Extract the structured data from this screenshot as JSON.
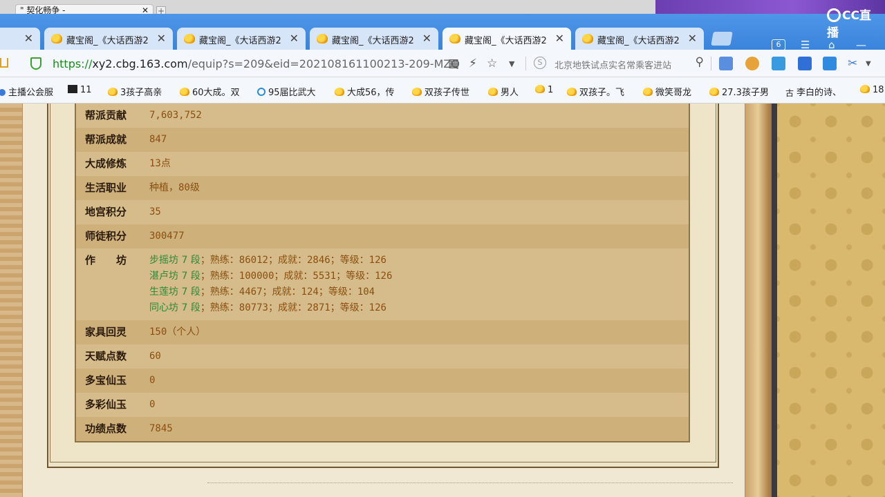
{
  "outer_tab": {
    "title": "\" 契化畅争 -"
  },
  "tabs": [
    {
      "title": "藏宝阁_《大话西游2"
    },
    {
      "title": "藏宝阁_《大话西游2"
    },
    {
      "title": "藏宝阁_《大话西游2"
    },
    {
      "title": "藏宝阁_《大话西游2",
      "active": true
    },
    {
      "title": "藏宝阁_《大话西游2"
    }
  ],
  "window": {
    "count": "6",
    "cc_label": "CC直播"
  },
  "address": {
    "scheme": "https://",
    "host": "xy2.cbg.163.com",
    "path": "/equip?s=209&eid=202108161100213-209-MZQ",
    "search_placeholder": "北京地铁试点实名常乘客进站"
  },
  "bookmarks": [
    {
      "label": "主播公会服"
    },
    {
      "label": "11"
    },
    {
      "label": "3孩子高亲"
    },
    {
      "label": "60大成。双"
    },
    {
      "label": "95届比武大"
    },
    {
      "label": "大成56，传"
    },
    {
      "label": "双孩子传世"
    },
    {
      "label": "男人"
    },
    {
      "label": "1"
    },
    {
      "label": "双孩子。飞"
    },
    {
      "label": "微笑哥龙"
    },
    {
      "label": "27.3孩子男"
    },
    {
      "label": "李白的诗、"
    },
    {
      "label": "18"
    }
  ],
  "info": {
    "bangpai_gongxian": {
      "label": "帮派贡献",
      "value": "7,603,752"
    },
    "bangpai_chengjiu": {
      "label": "帮派成就",
      "value": "847"
    },
    "dacheng_xiulian": {
      "label": "大成修炼",
      "value": "13点"
    },
    "shenghuo_zhiye": {
      "label": "生活职业",
      "value": "种植，80级"
    },
    "digong_jifen": {
      "label": "地宫积分",
      "value": "35"
    },
    "shitu_jifen": {
      "label": "师徒积分",
      "value": "300477"
    },
    "zuofang": {
      "label": "作　　坊",
      "lines": [
        {
          "name": "步摇坊 7 段",
          "rest": "；熟练：86012；成就：2846；等级：126"
        },
        {
          "name": "湛卢坊 7 段",
          "rest": "；熟练：100000；成就：5531；等级：126"
        },
        {
          "name": "生莲坊 7 段",
          "rest": "；熟练：4467；成就：124；等级：104"
        },
        {
          "name": "同心坊 7 段",
          "rest": "；熟练：80773；成就：2871；等级：126"
        }
      ]
    },
    "jiaju_huiling": {
      "label": "家具回灵",
      "value": "150（个人）"
    },
    "tianfu_dianshu": {
      "label": "天赋点数",
      "value": "60"
    },
    "duobao_xianyu": {
      "label": "多宝仙玉",
      "value": "0"
    },
    "duocai_xianyu": {
      "label": "多彩仙玉",
      "value": "0"
    },
    "gongji_dianshu": {
      "label": "功绩点数",
      "value": "7845"
    }
  }
}
